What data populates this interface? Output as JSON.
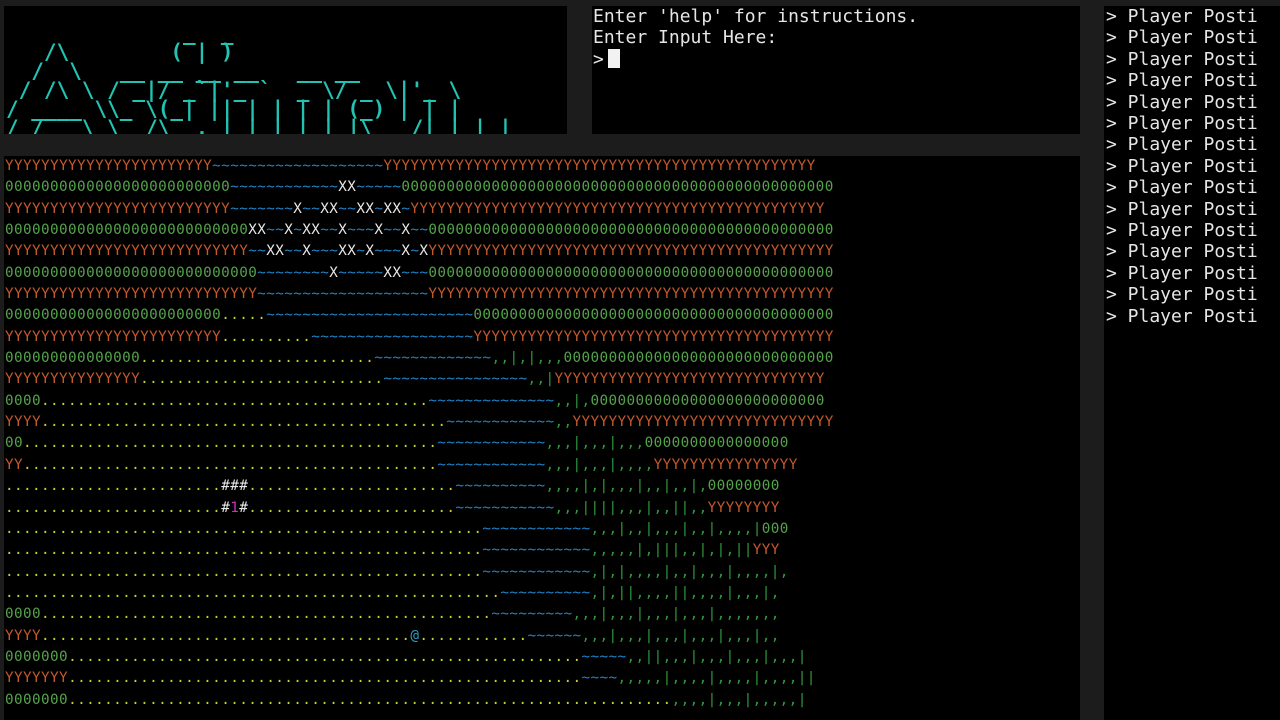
{
  "logo": {
    "art": "              _  _\n   /\\        ( | )\n  /  \\   __ __ __ __   __ __\n / /\\ \\ / _|/ _`|'_ `  _ \\/ _ \\|'_ \\\n/ ____ \\\\_ \\(_| || | | | | (_) | | |\n/_/   \\_\\__/\\__,_|_| |_| |_|\\___/|_| |_|",
    "color": "#22c3b3"
  },
  "console": {
    "lines": [
      "Enter 'help' for instructions.",
      "Enter Input Here:"
    ],
    "prompt": ">"
  },
  "log": {
    "entries": [
      "> Player Posti",
      "> Player Posti",
      "> Player Posti",
      "> Player Posti",
      "> Player Posti",
      "> Player Posti",
      "> Player Posti",
      "> Player Posti",
      "> Player Posti",
      "> Player Posti",
      "> Player Posti",
      "> Player Posti",
      "> Player Posti",
      "> Player Posti",
      "> Player Posti"
    ]
  },
  "colors": {
    "Y": "#c4592c",
    "0": "#55a34b",
    ".": "#c7d42a",
    "~": "#1f84c8",
    "X": "#e8e8e8",
    "|": "#2e9a3c",
    ",": "#2e9a3c",
    "#": "#e8e8e8",
    "1": "#d22dc0",
    "@": "#2a9fc9"
  },
  "map": {
    "rows": [
      "YYYYYYYYYYYYYYYYYYYYYYY~~~~~~~~~~~~~~~~~~~YYYYYYYYYYYYYYYYYYYYYYYYYYYYYYYYYYYYYYYYYYYYYYYY",
      "0000000000000000000000000~~~~~~~~~~~~XX~~~~~000000000000000000000000000000000000000000000000",
      "YYYYYYYYYYYYYYYYYYYYYYYYY~~~~~~~X~~XX~~XX~XX~YYYYYYYYYYYYYYYYYYYYYYYYYYYYYYYYYYYYYYYYYYYYYY",
      "000000000000000000000000000XX~~X~XX~~X~~~X~~X~~000000000000000000000000000000000000000000000",
      "YYYYYYYYYYYYYYYYYYYYYYYYYYY~~XX~~X~~~XX~X~~~X~XYYYYYYYYYYYYYYYYYYYYYYYYYYYYYYYYYYYYYYYYYYYYY",
      "0000000000000000000000000000~~~~~~~~X~~~~~XX~~~000000000000000000000000000000000000000000000",
      "YYYYYYYYYYYYYYYYYYYYYYYYYYYY~~~~~~~~~~~~~~~~~~~YYYYYYYYYYYYYYYYYYYYYYYYYYYYYYYYYYYYYYYYYYYYY",
      "000000000000000000000000.....~~~~~~~~~~~~~~~~~~~~~~~0000000000000000000000000000000000000000",
      "YYYYYYYYYYYYYYYYYYYYYYYY..........~~~~~~~~~~~~~~~~~~YYYYYYYYYYYYYYYYYYYYYYYYYYYYYYYYYYYYYYYY",
      "000000000000000..........................~~~~~~~~~~~~~,,|,|,,,000000000000000000000000000000",
      "YYYYYYYYYYYYYYY...........................~~~~~~~~~~~~~~~~,,|YYYYYYYYYYYYYYYYYYYYYYYYYYYYYY",
      "0000...........................................~~~~~~~~~~~~~~,,|,00000000000000000000000000",
      "YYYY.............................................~~~~~~~~~~~~,,YYYYYYYYYYYYYYYYYYYYYYYYYYYYY",
      "00..............................................~~~~~~~~~~~~,,,|,,,|,,,0000000000000000",
      "YY..............................................~~~~~~~~~~~~,,,|,,,|,,,,YYYYYYYYYYYYYYYY",
      "........................###.......................~~~~~~~~~~,,,,|,|,,,|,,|,,|,00000000",
      "........................#1#.......................~~~~~~~~~~~,,,||||,,,|,,||,,YYYYYYYY",
      ".....................................................~~~~~~~~~~~~,,,|,,|,,,|,,|,,,,|000",
      ".....................................................~~~~~~~~~~~~,,,,,|,|||,,|,|,||YYY",
      ".....................................................~~~~~~~~~~~~,|,|,,,,|,,|,,,|,,,,|,",
      ".......................................................~~~~~~~~~~,|,||,,,,||,,,,|,,,|,",
      "0000..................................................~~~~~~~~~,,,|,,,|,,,|,,,|,,,,,,,",
      "YYYY.........................................@............~~~~~~,,,|,,,|,,,|,,,|,,,|,,",
      "0000000.........................................................~~~~~,,||,,,|,,,|,,,|,,,|",
      "YYYYYYY.........................................................~~~~,,,,,|,,,,|,,,,|,,,,||",
      "0000000...................................................................,,,,|,,,|,,,,,|"
    ]
  }
}
